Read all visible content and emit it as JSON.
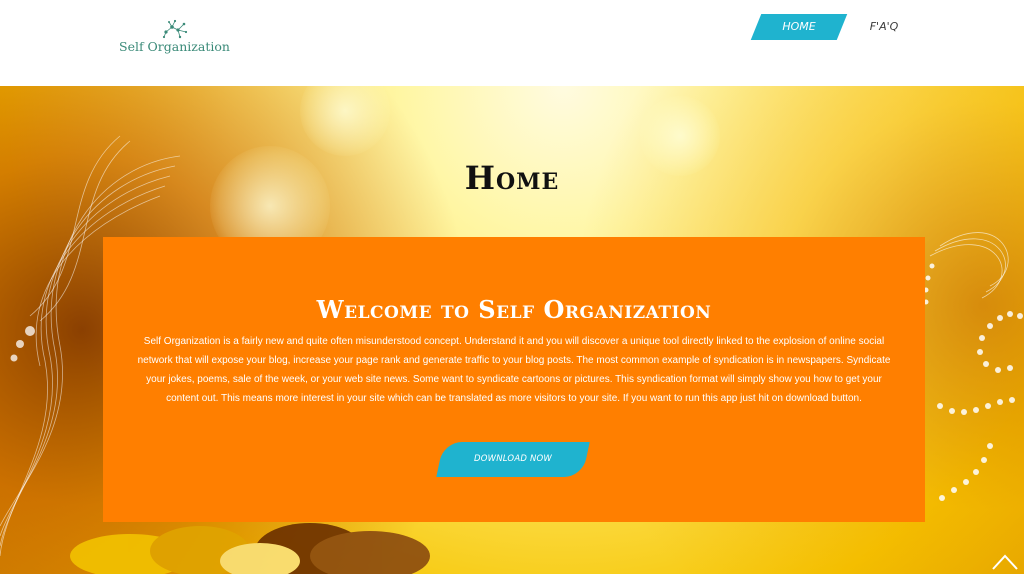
{
  "header": {
    "logo_text": "Self Organization",
    "logo_icon": "network-nodes-icon",
    "nav": [
      {
        "label": "HOME",
        "active": true
      },
      {
        "label": "F'A'Q"
      }
    ]
  },
  "main": {
    "page_title": "Home",
    "card": {
      "title": "Welcome to Self Organization",
      "body": "Self Organization is a fairly new and quite often misunderstood concept. Understand it and you will discover a unique tool directly linked to the explosion of online social network that will expose your blog, increase your page rank and generate traffic to your blog posts. The most common example of syndication is in newspapers. Syndicate your jokes, poems, sale of the week, or your web site news. Some want to syndicate cartoons or pictures. This syndication format will simply show you how to get your content out. This means more interest in your site which can be translated as more visitors to your site. If you want to run this app just hit on download button.",
      "button_label": "DOWNLOAD NOW"
    },
    "scroll_top_icon": "chevron-up-icon"
  },
  "colors": {
    "accent": "#1fb3cf",
    "card": "#ff7f00",
    "logo_text": "#3a8a78"
  }
}
